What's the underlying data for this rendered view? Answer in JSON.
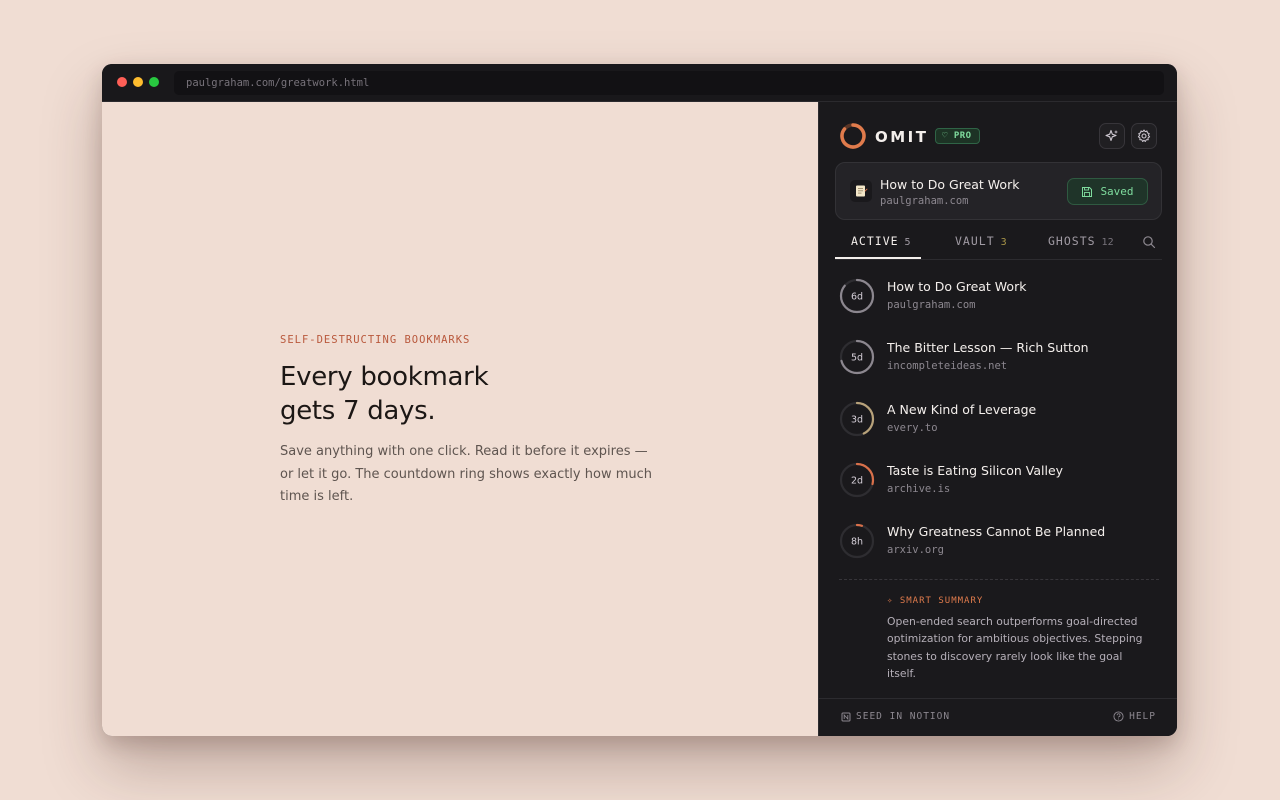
{
  "browser": {
    "url": "paulgraham.com/greatwork.html"
  },
  "page": {
    "eyebrow": "SELF-DESTRUCTING BOOKMARKS",
    "headline_line1": "Every bookmark",
    "headline_line2": "gets 7 days.",
    "body": "Save anything with one click. Read it before it expires — or let it go. The countdown ring shows exactly how much time is left."
  },
  "panel": {
    "brand": "OMIT",
    "badge": "PRO",
    "current": {
      "title": "How to Do Great Work",
      "domain": "paulgraham.com",
      "status": "Saved"
    },
    "tabs": [
      {
        "label": "ACTIVE",
        "count": "5"
      },
      {
        "label": "VAULT",
        "count": "3"
      },
      {
        "label": "GHOSTS",
        "count": "12"
      }
    ],
    "items": [
      {
        "ring": "6d",
        "remaining_fraction": 0.86,
        "title": "How to Do Great Work",
        "domain": "paulgraham.com"
      },
      {
        "ring": "5d",
        "remaining_fraction": 0.71,
        "title": "The Bitter Lesson — Rich Sutton",
        "domain": "incompleteideas.net"
      },
      {
        "ring": "3d",
        "remaining_fraction": 0.43,
        "title": "A New Kind of Leverage",
        "domain": "every.to"
      },
      {
        "ring": "2d",
        "remaining_fraction": 0.29,
        "title": "Taste is Eating Silicon Valley",
        "domain": "archive.is"
      },
      {
        "ring": "8h",
        "remaining_fraction": 0.05,
        "title": "Why Greatness Cannot Be Planned",
        "domain": "arxiv.org"
      }
    ],
    "summary": {
      "label": "SMART SUMMARY",
      "text": "Open-ended search outperforms goal-directed optimization for ambitious objectives. Stepping stones to discovery rarely look like the goal itself."
    },
    "footer": {
      "left": "SEED IN NOTION",
      "right": "HELP"
    }
  },
  "colors": {
    "accent": "#e07b4c",
    "saved": "#7fdc9e",
    "ring_normal": "#8c878f",
    "ring_mid": "#b8a27a",
    "ring_urgent": "#d9704a"
  }
}
